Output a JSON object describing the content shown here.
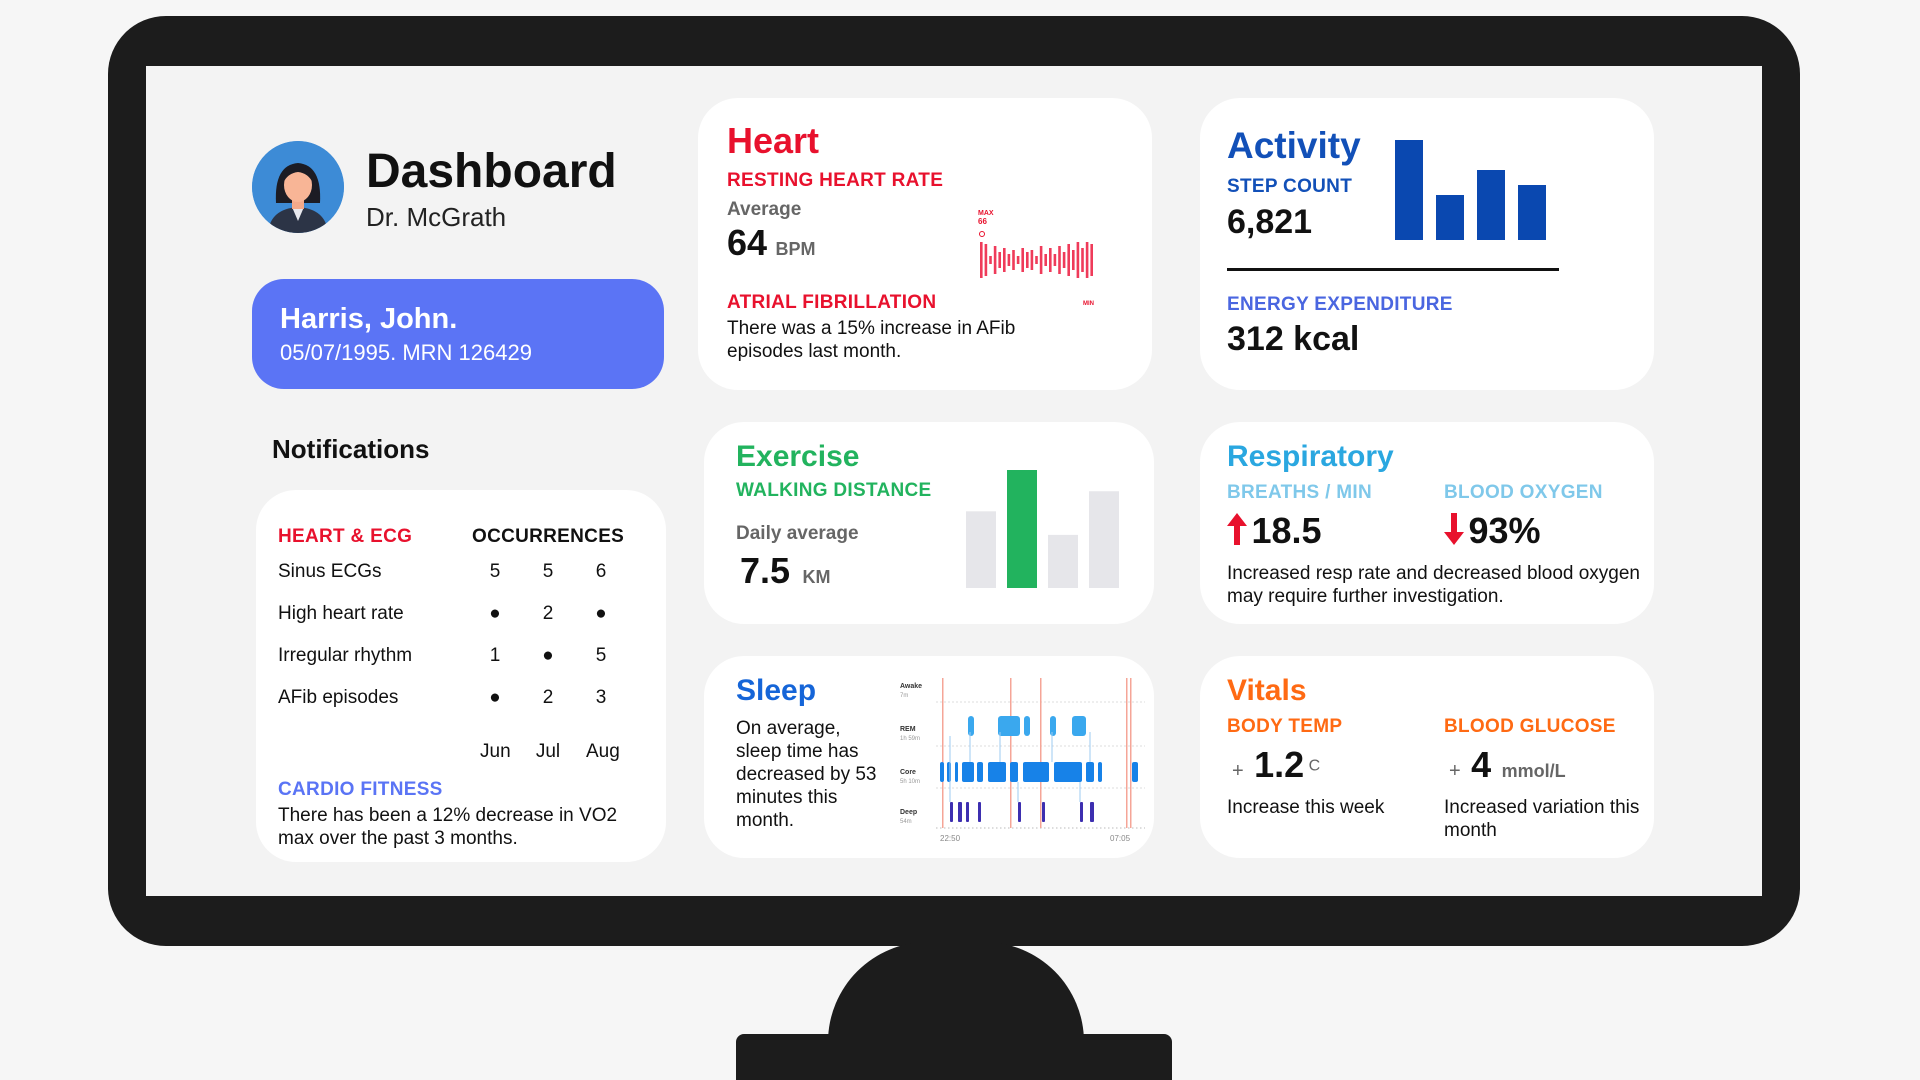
{
  "header": {
    "title": "Dashboard",
    "doctor": "Dr. McGrath"
  },
  "patient": {
    "name": "Harris, John.",
    "meta": "05/07/1995. MRN 126429"
  },
  "notifications": {
    "title": "Notifications",
    "col_category": "HEART & ECG",
    "col_occurrences": "OCCURRENCES",
    "rows": [
      {
        "label": "Sinus ECGs",
        "values": [
          "5",
          "5",
          "6"
        ]
      },
      {
        "label": "High heart rate",
        "values": [
          "●",
          "2",
          "●"
        ]
      },
      {
        "label": "Irregular rhythm",
        "values": [
          "1",
          "●",
          "5"
        ]
      },
      {
        "label": "AFib episodes",
        "values": [
          "●",
          "2",
          "3"
        ]
      }
    ],
    "months": [
      "Jun",
      "Jul",
      "Aug"
    ],
    "cardio_label": "CARDIO FITNESS",
    "cardio_text": "There has been a 12% decrease in VO2 max over the past 3 months."
  },
  "heart": {
    "title": "Heart",
    "rhr_label": "RESTING HEART RATE",
    "avg_label": "Average",
    "value": "64",
    "unit": "BPM",
    "chart_max_label": "MAX",
    "chart_max_value": "66",
    "chart_min_label": "MIN",
    "afib_label": "ATRIAL FIBRILLATION",
    "afib_text": "There was a 15% increase in AFib episodes last month."
  },
  "activity": {
    "title": "Activity",
    "step_label": "STEP COUNT",
    "steps": "6,821",
    "energy_label": "ENERGY EXPENDITURE",
    "energy_value": "312 kcal"
  },
  "exercise": {
    "title": "Exercise",
    "walk_label": "WALKING DISTANCE",
    "daily_label": "Daily average",
    "value": "7.5",
    "unit": "KM"
  },
  "respiratory": {
    "title": "Respiratory",
    "breaths_label": "BREATHS / MIN",
    "breaths_value": "18.5",
    "oxygen_label": "BLOOD OXYGEN",
    "oxygen_value": "93%",
    "note": "Increased resp rate and decreased blood oxygen may require further investigation."
  },
  "sleep": {
    "title": "Sleep",
    "text": "On average, sleep time has decreased by 53 minutes this month.",
    "stages": [
      {
        "name": "Awake",
        "dur": "7m"
      },
      {
        "name": "REM",
        "dur": "1h 59m"
      },
      {
        "name": "Core",
        "dur": "5h 10m"
      },
      {
        "name": "Deep",
        "dur": "54m"
      }
    ],
    "start": "22:50",
    "end": "07:05"
  },
  "vitals": {
    "title": "Vitals",
    "temp_label": "BODY TEMP",
    "temp_sign": "+",
    "temp_value": "1.2",
    "temp_unit": "C",
    "temp_note": "Increase this week",
    "glucose_label": "BLOOD GLUCOSE",
    "glucose_sign": "+",
    "glucose_value": "4",
    "glucose_unit": "mmol/L",
    "glucose_note": "Increased variation this month"
  },
  "colors": {
    "heart": "#e8112d",
    "activity": "#1250b8",
    "exercise": "#22b35e",
    "respiratory": "#2aa7e0",
    "vitals": "#ff6a13",
    "patient_card": "#5b74f5"
  },
  "icons": {
    "avatar": "doctor-avatar-icon",
    "up": "arrow-up-icon",
    "down": "arrow-down-icon"
  },
  "chart_data": [
    {
      "type": "bar",
      "title": "Heart rate",
      "values": [
        9,
        8,
        2,
        7,
        4,
        6,
        3,
        5,
        2,
        6,
        4,
        5,
        2,
        7,
        3,
        6,
        3,
        7,
        4,
        8,
        5,
        9,
        6,
        9,
        8
      ],
      "ylim": [
        0,
        10
      ]
    },
    {
      "type": "bar",
      "title": "Step count",
      "values": [
        10,
        4.5,
        7,
        5.5
      ],
      "ylim": [
        0,
        10
      ]
    },
    {
      "type": "bar",
      "title": "Walking distance",
      "values": [
        6.5,
        10,
        4.5,
        8.2
      ],
      "highlight_index": 1,
      "ylim": [
        0,
        10
      ]
    },
    {
      "type": "bar",
      "title": "Sleep stages",
      "categories": [
        "Awake",
        "REM",
        "Core",
        "Deep"
      ]
    }
  ]
}
